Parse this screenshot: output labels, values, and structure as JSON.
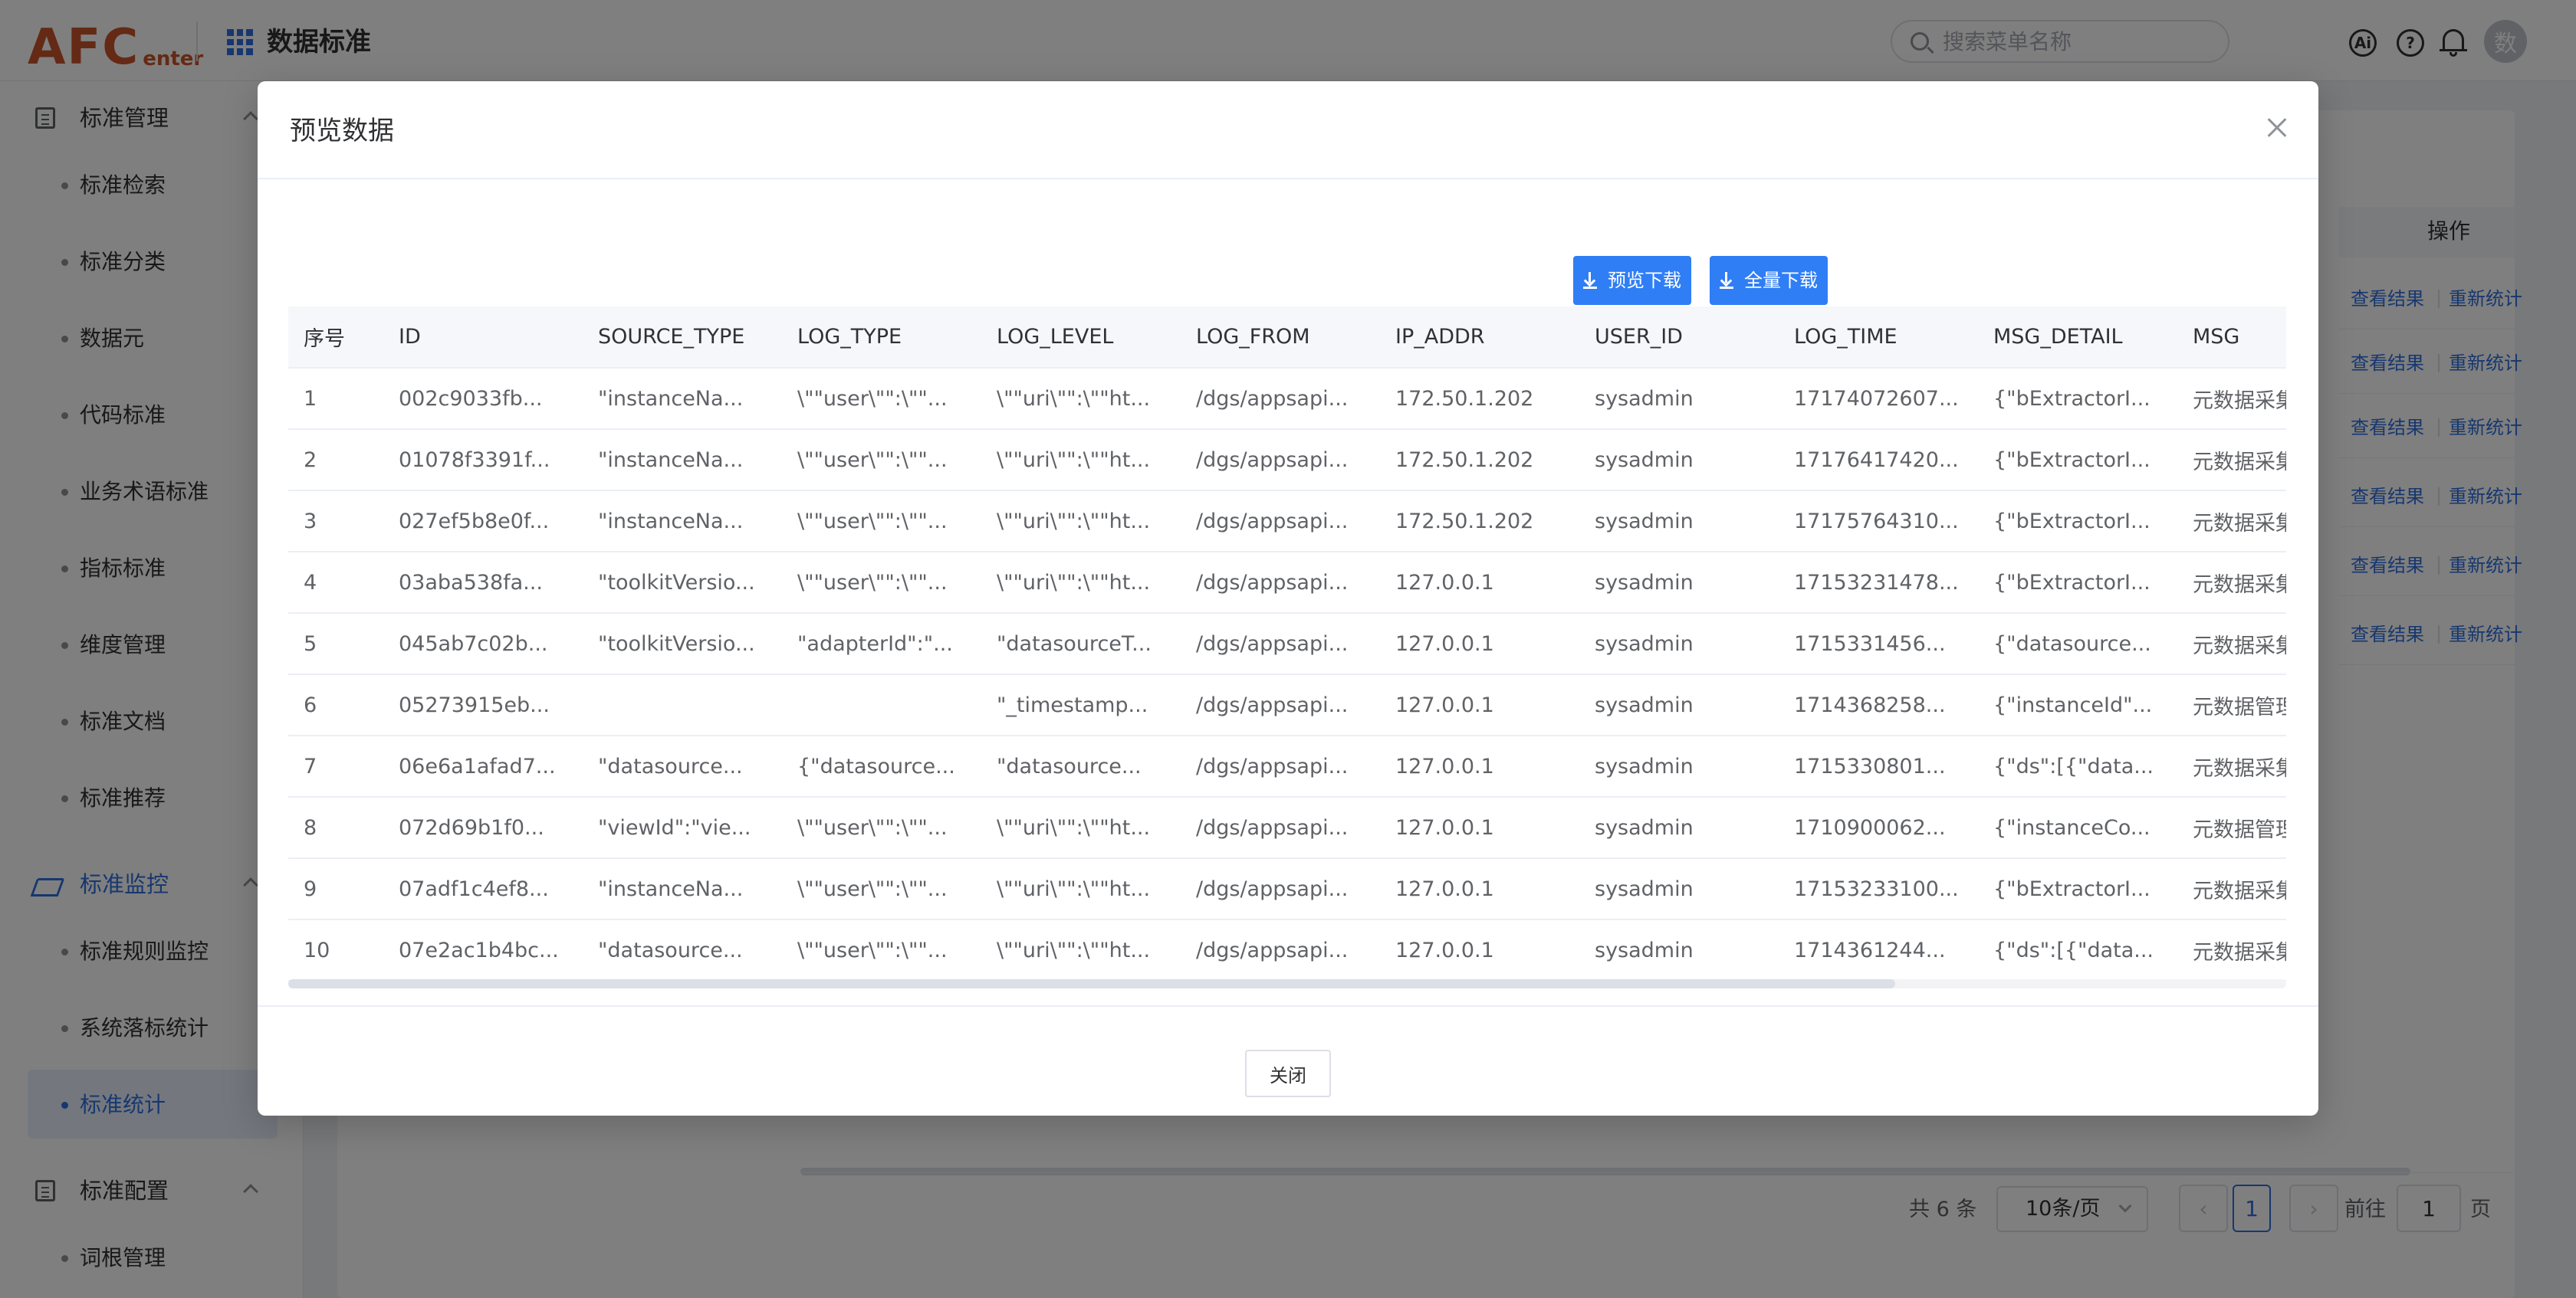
{
  "header": {
    "logo_main": "AFC",
    "logo_sub": "enter",
    "app_title": "数据标准",
    "search_placeholder": "搜索菜单名称",
    "ai_label": "Ai",
    "help_label": "?",
    "avatar_text": "数"
  },
  "sidebar": {
    "group_manage": "标准管理",
    "manage_items": [
      "标准检索",
      "标准分类",
      "数据元",
      "代码标准",
      "业务术语标准",
      "指标标准",
      "维度管理",
      "标准文档",
      "标准推荐"
    ],
    "group_monitor": "标准监控",
    "monitor_items": [
      "标准规则监控",
      "系统落标统计",
      "标准统计"
    ],
    "group_config": "标准配置",
    "config_items": [
      "词根管理"
    ]
  },
  "background": {
    "op_header": "操作",
    "link_view": "查看结果",
    "link_rerun": "重新统计",
    "pager": {
      "total": "共 6 条",
      "page_size": "10条/页",
      "prev": "‹",
      "current": "1",
      "next": "›",
      "goto_label": "前往",
      "goto_value": "1",
      "page_suffix": "页"
    }
  },
  "dialog": {
    "title": "预览数据",
    "btn_preview_download": "预览下载",
    "btn_full_download": "全量下载",
    "btn_close": "关闭",
    "columns": [
      "序号",
      "ID",
      "SOURCE_TYPE",
      "LOG_TYPE",
      "LOG_LEVEL",
      "LOG_FROM",
      "IP_ADDR",
      "USER_ID",
      "LOG_TIME",
      "MSG_DETAIL",
      "MSG"
    ],
    "rows": [
      [
        "1",
        "002c9033fb...",
        "\"instanceNa...",
        "\\\"\"user\\\"\":\\\"\"...",
        "\\\"\"uri\\\"\":\\\"\"ht...",
        "/dgs/appsapi...",
        "172.50.1.202",
        "sysadmin",
        "17174072607...",
        "{\"bExtractorI...",
        "元数据采集"
      ],
      [
        "2",
        "01078f3391f...",
        "\"instanceNa...",
        "\\\"\"user\\\"\":\\\"\"...",
        "\\\"\"uri\\\"\":\\\"\"ht...",
        "/dgs/appsapi...",
        "172.50.1.202",
        "sysadmin",
        "17176417420...",
        "{\"bExtractorI...",
        "元数据采集"
      ],
      [
        "3",
        "027ef5b8e0f...",
        "\"instanceNa...",
        "\\\"\"user\\\"\":\\\"\"...",
        "\\\"\"uri\\\"\":\\\"\"ht...",
        "/dgs/appsapi...",
        "172.50.1.202",
        "sysadmin",
        "17175764310...",
        "{\"bExtractorI...",
        "元数据采集"
      ],
      [
        "4",
        "03aba538fa...",
        "\"toolkitVersio...",
        "\\\"\"user\\\"\":\\\"\"...",
        "\\\"\"uri\\\"\":\\\"\"ht...",
        "/dgs/appsapi...",
        "127.0.0.1",
        "sysadmin",
        "17153231478...",
        "{\"bExtractorI...",
        "元数据采集"
      ],
      [
        "5",
        "045ab7c02b...",
        "\"toolkitVersio...",
        "\"adapterId\":\"...",
        "\"datasourceT...",
        "/dgs/appsapi...",
        "127.0.0.1",
        "sysadmin",
        "1715331456...",
        "{\"datasource...",
        "元数据采集"
      ],
      [
        "6",
        "05273915eb...",
        "",
        "",
        "\"_timestamp...",
        "/dgs/appsapi...",
        "127.0.0.1",
        "sysadmin",
        "1714368258...",
        "{\"instanceId\"...",
        "元数据管理"
      ],
      [
        "7",
        "06e6a1afad7...",
        "\"datasource...",
        "{\"datasource...",
        "\"datasource...",
        "/dgs/appsapi...",
        "127.0.0.1",
        "sysadmin",
        "1715330801...",
        "{\"ds\":[{\"data...",
        "元数据采集"
      ],
      [
        "8",
        "072d69b1f0...",
        "\"viewId\":\"vie...",
        "\\\"\"user\\\"\":\\\"\"...",
        "\\\"\"uri\\\"\":\\\"\"ht...",
        "/dgs/appsapi...",
        "127.0.0.1",
        "sysadmin",
        "1710900062...",
        "{\"instanceCo...",
        "元数据管理"
      ],
      [
        "9",
        "07adf1c4ef8...",
        "\"instanceNa...",
        "\\\"\"user\\\"\":\\\"\"...",
        "\\\"\"uri\\\"\":\\\"\"ht...",
        "/dgs/appsapi...",
        "127.0.0.1",
        "sysadmin",
        "17153233100...",
        "{\"bExtractorI...",
        "元数据采集"
      ],
      [
        "10",
        "07e2ac1b4bc...",
        "\"datasource...",
        "\\\"\"user\\\"\":\\\"\"...",
        "\\\"\"uri\\\"\":\\\"\"ht...",
        "/dgs/appsapi...",
        "127.0.0.1",
        "sysadmin",
        "1714361244...",
        "{\"ds\":[{\"data...",
        "元数据采集"
      ]
    ]
  },
  "colors": {
    "brand": "#c8552a",
    "primary": "#2f7ef5",
    "accent_text": "#2f6fdf"
  }
}
